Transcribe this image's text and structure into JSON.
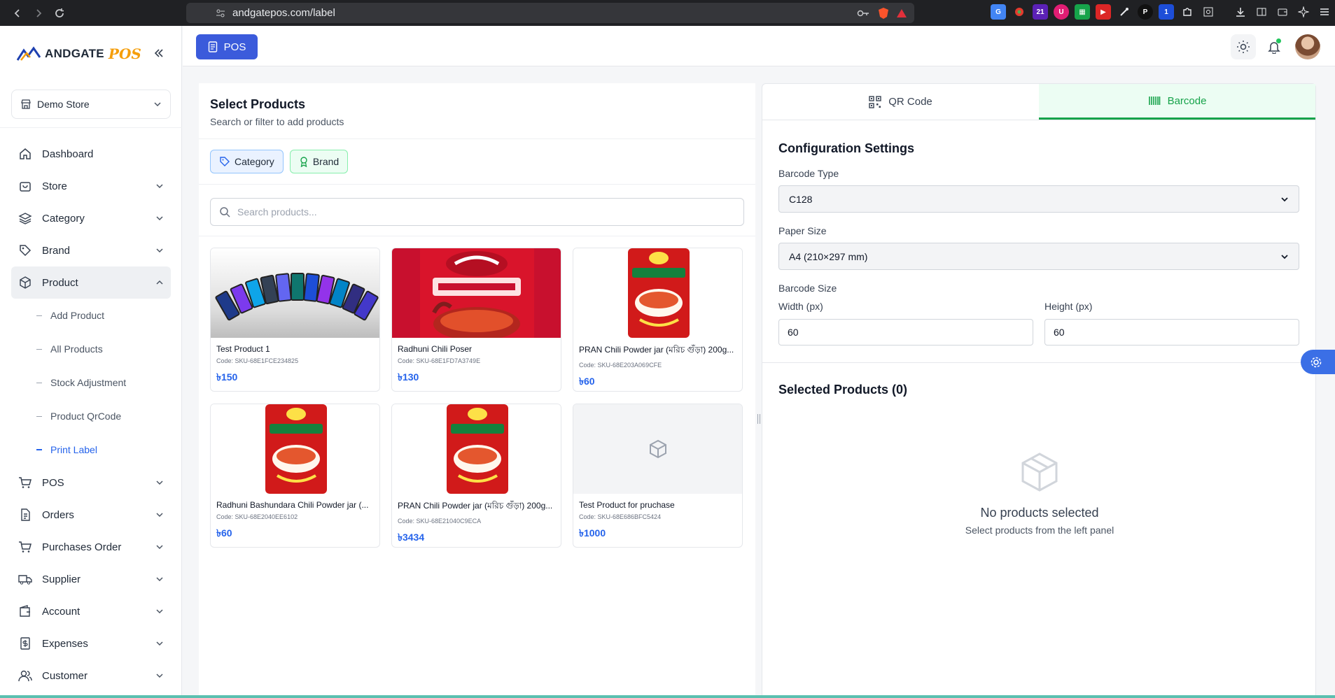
{
  "browser": {
    "url": "andgatepos.com/label",
    "extension_badges": [
      "21",
      "1"
    ]
  },
  "sidebar": {
    "logo_text": "ANDGATE",
    "logo_accent": "POS",
    "store": "Demo Store",
    "items": [
      {
        "label": "Dashboard",
        "icon": "home-icon"
      },
      {
        "label": "Store",
        "icon": "store-icon"
      },
      {
        "label": "Category",
        "icon": "layers-icon"
      },
      {
        "label": "Brand",
        "icon": "tag-icon"
      },
      {
        "label": "Product",
        "icon": "box-icon"
      },
      {
        "label": "POS",
        "icon": "cart-icon"
      },
      {
        "label": "Orders",
        "icon": "document-icon"
      },
      {
        "label": "Purchases Order",
        "icon": "cart-icon"
      },
      {
        "label": "Supplier",
        "icon": "truck-icon"
      },
      {
        "label": "Account",
        "icon": "wallet-icon"
      },
      {
        "label": "Expenses",
        "icon": "receipt-icon"
      },
      {
        "label": "Customer",
        "icon": "users-icon"
      }
    ],
    "product_sub": [
      "Add Product",
      "All Products",
      "Stock Adjustment",
      "Product QrCode",
      "Print Label"
    ],
    "active_sub": "Print Label"
  },
  "topbar": {
    "pos_label": "POS"
  },
  "left": {
    "title": "Select Products",
    "subtitle": "Search or filter to add products",
    "filter_category": "Category",
    "filter_brand": "Brand",
    "search_placeholder": "Search products...",
    "products": [
      {
        "name": "Test Product 1",
        "code": "Code: SKU-68E1FCE234825",
        "price": "৳150",
        "image": "phones"
      },
      {
        "name": "Radhuni Chili Poser",
        "code": "Code: SKU-68E1FD7A3749E",
        "price": "৳130",
        "image": "packet"
      },
      {
        "name": "PRAN Chili Powder jar (মরিচ গুঁড়া) 200g...",
        "code": "Code: SKU-68E203A069CFE",
        "price": "৳60",
        "image": "jar"
      },
      {
        "name": "Radhuni Bashundara Chili Powder jar (...",
        "code": "Code: SKU-68E2040EE6102",
        "price": "৳60",
        "image": "jar"
      },
      {
        "name": "PRAN Chili Powder jar (মরিচ গুঁড়া) 200g...",
        "code": "Code: SKU-68E21040C9ECA",
        "price": "৳3434",
        "image": "jar"
      },
      {
        "name": "Test Product for pruchase",
        "code": "Code: SKU-68E686BFC5424",
        "price": "৳1000",
        "image": "none"
      }
    ]
  },
  "right": {
    "tab_qr": "QR Code",
    "tab_barcode": "Barcode",
    "config_title": "Configuration Settings",
    "barcode_type_label": "Barcode Type",
    "barcode_type": "C128",
    "paper_size_label": "Paper Size",
    "paper_size": "A4 (210×297 mm)",
    "barcode_size_label": "Barcode Size",
    "width_label": "Width (px)",
    "width": "60",
    "height_label": "Height (px)",
    "height": "60",
    "selected_title": "Selected Products (0)",
    "empty_title": "No products selected",
    "empty_sub": "Select products from the left panel"
  },
  "colors": {
    "primary": "#3b5bdb",
    "price": "#2563eb",
    "active_tab": "#16a34a",
    "logo_accent": "#f59e0b"
  }
}
